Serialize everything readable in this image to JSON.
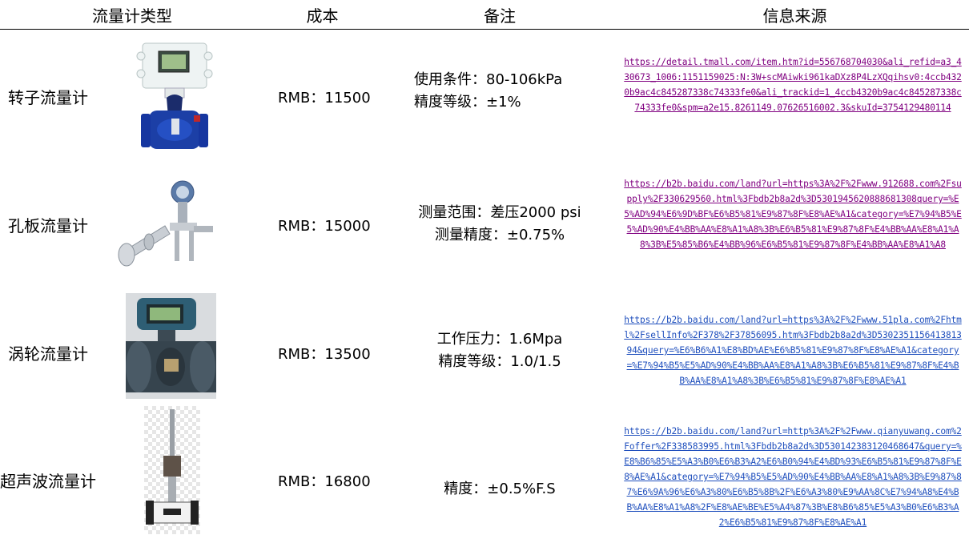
{
  "header": {
    "col_type": "流量计类型",
    "col_cost": "成本",
    "col_note": "备注",
    "col_source": "信息来源"
  },
  "rows": [
    {
      "type": "转子流量计",
      "cost": "RMB：11500",
      "note_lines": [
        "使用条件：80-106kPa",
        "精度等级：±1%"
      ],
      "source": "https://detail.tmall.com/item.htm?id=556768704030&ali_refid=a3_430673_1006:1151159025:N:3W+scMAiwki961kaDXz8P4LzXQqihsv0:4ccb4320b9ac4c845287338c74333fe0&ali_trackid=1_4ccb4320b9ac4c845287338c74333fe0&spm=a2e15.8261149.07626516002.3&skuId=3754129480114",
      "image_icon": "rotameter-image"
    },
    {
      "type": "孔板流量计",
      "cost": "RMB：15000",
      "note_lines": [
        "测量范围：差压2000 psi",
        "测量精度：±0.75%"
      ],
      "source": "https://b2b.baidu.com/land?url=https%3A%2F%2Fwww.912688.com%2Fsupply%2F330629560.html%3Fbdb2b8a2d%3D5301945620888681308query=%E5%AD%94%E6%9D%BF%E6%B5%81%E9%87%8F%E8%AE%A1&category=%E7%94%B5%E5%AD%90%E4%BB%AA%E8%A1%A8%3B%E6%B5%81%E9%87%8F%E4%BB%AA%E8%A1%A8%3B%E5%85%B6%E4%BB%96%E6%B5%81%E9%87%8F%E4%BB%AA%E8%A1%A8",
      "image_icon": "orifice-meter-image"
    },
    {
      "type": "涡轮流量计",
      "cost": "RMB：13500",
      "note_lines": [
        "工作压力：1.6Mpa",
        "精度等级：1.0/1.5"
      ],
      "source": "https://b2b.baidu.com/land?url=https%3A%2F%2Fwww.51pla.com%2Fhtml%2FsellInfo%2F378%2F37856095.htm%3Fbdb2b8a2d%3D530235115641381394&query=%E6%B6%A1%E8%BD%AE%E6%B5%81%E9%87%8F%E8%AE%A1&category=%E7%94%B5%E5%AD%90%E4%BB%AA%E8%A1%A8%3B%E6%B5%81%E9%87%8F%E4%BB%AA%E8%A1%A8%3B%E6%B5%81%E9%87%8F%E8%AE%A1",
      "image_icon": "turbine-meter-image"
    },
    {
      "type": "超声波流量计",
      "cost": "RMB：16800",
      "note_lines": [
        "精度：±0.5%F.S"
      ],
      "source": "https://b2b.baidu.com/land?url=http%3A%2F%2Fwww.qianyuwang.com%2Foffer%2F338583995.html%3Fbdb2b8a2d%3D530142383120468647&query=%E8%B6%85%E5%A3%B0%E6%B3%A2%E6%B0%94%E4%BD%93%E6%B5%81%E9%87%8F%E8%AE%A1&category=%E7%94%B5%E5%AD%90%E4%BB%AA%E8%A1%A8%3B%E9%87%87%E6%9A%96%E6%A3%80%E6%B5%8B%2F%E6%A3%80%E9%AA%8C%E7%94%A8%E4%BB%AA%E8%A1%A8%2F%E8%AE%BE%E5%A4%87%3B%E8%B6%85%E5%A3%B0%E6%B3%A2%E6%B5%81%E9%87%8F%E8%AE%A1",
      "image_icon": "ultrasonic-meter-image"
    }
  ],
  "colors": {
    "visited_link": "#800080",
    "link": "#1f4fbd"
  }
}
